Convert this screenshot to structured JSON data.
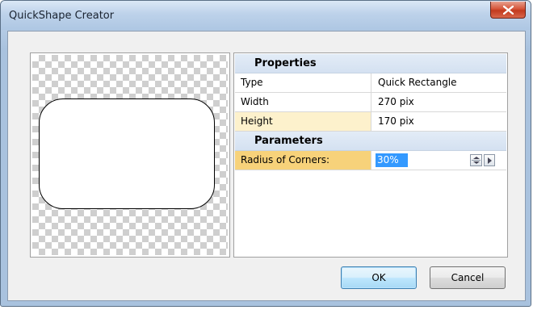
{
  "window": {
    "title": "QuickShape Creator"
  },
  "grid": {
    "properties_header": "Properties",
    "properties": [
      {
        "name": "Type",
        "value": "Quick Rectangle"
      },
      {
        "name": "Width",
        "value": "270 pix"
      },
      {
        "name": "Height",
        "value": "170 pix"
      }
    ],
    "parameters_header": "Parameters",
    "parameter": {
      "name": "Radius of Corners:",
      "value": "30%"
    }
  },
  "buttons": {
    "ok": "OK",
    "cancel": "Cancel"
  },
  "colors": {
    "selection": "#3399ff",
    "active_row": "#f7d27a",
    "highlight_row": "#fdf1cc",
    "close_button": "#d6553a"
  }
}
